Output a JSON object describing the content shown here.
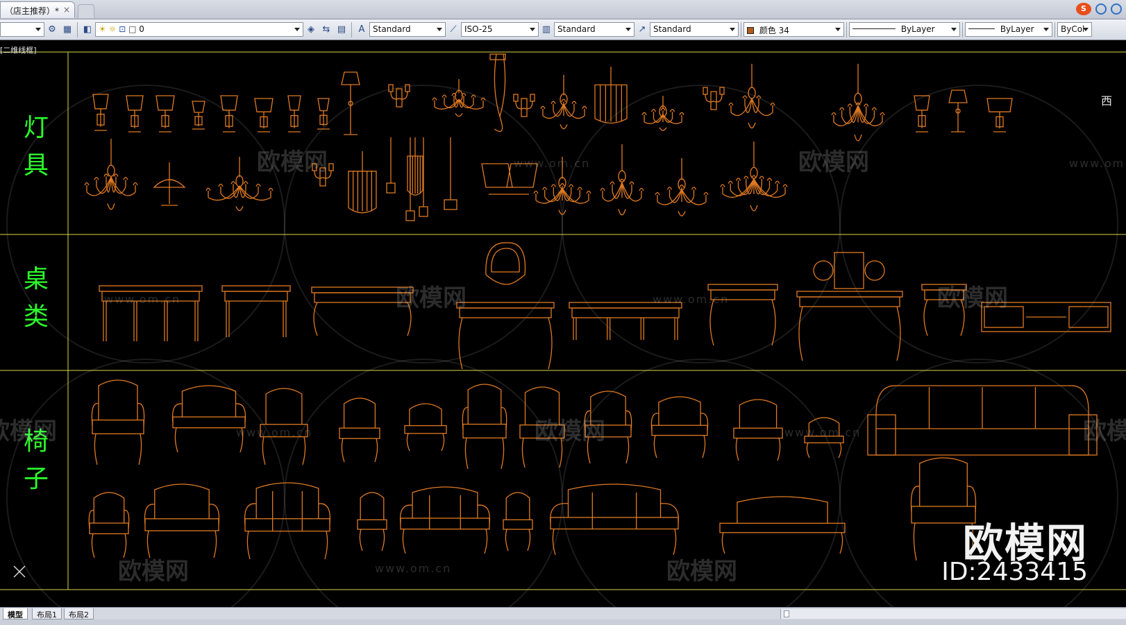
{
  "document_tab": {
    "title": "（店主推荐）*",
    "close": "×"
  },
  "toolbar": {
    "layer_value": "0",
    "text_style": "Standard",
    "dim_style": "ISO-25",
    "table_style": "Standard",
    "multileader_style": "Standard",
    "color_value": "颜色 34",
    "linetype_value": "ByLayer",
    "lineweight_value": "ByLayer",
    "plotstyle_value": "ByCol"
  },
  "canvas": {
    "viewport_label": "[二维线框]",
    "viewcube_label": "西",
    "categories": [
      {
        "line1": "灯",
        "line2": "具"
      },
      {
        "line1": "桌",
        "line2": "类"
      },
      {
        "line1": "椅",
        "line2": "子"
      }
    ]
  },
  "watermark": {
    "brand": "欧模网",
    "url": "www.om.cn",
    "id": "ID:2433415"
  },
  "layout_tabs": [
    "模型",
    "布局1",
    "布局2"
  ],
  "colors": {
    "background": "#000000",
    "frame": "#d8d84a",
    "drawing": "#e07a22",
    "detail": "#b9b9b9",
    "category_label": "#2bff2b"
  }
}
